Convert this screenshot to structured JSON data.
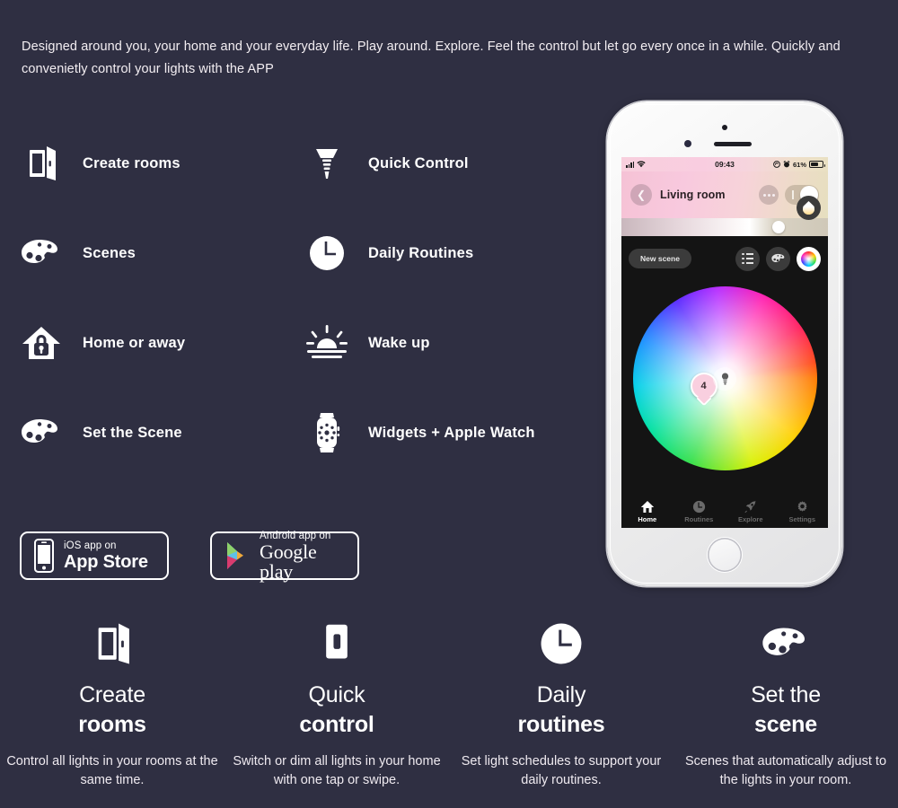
{
  "theme": {
    "background": "#2f2f42",
    "text_primary": "#ffffff",
    "text_body": "#efeaf0",
    "phone_screen_bg": "#141414",
    "accent_pink": "#f9cfdf"
  },
  "intro": {
    "paragraph": "Designed around you, your home and your everyday life. Play around. Explore. Feel the control but let go every once in a while. Quickly and convenietly control your lights with the  APP"
  },
  "features": [
    {
      "label": "Create rooms",
      "icon": "open-door-icon"
    },
    {
      "label": "Quick Control",
      "icon": "light-bulb-icon"
    },
    {
      "label": "Scenes",
      "icon": "paint-palette-icon"
    },
    {
      "label": "Daily Routines",
      "icon": "clock-icon"
    },
    {
      "label": "Home or away",
      "icon": "house-lock-icon"
    },
    {
      "label": "Wake up",
      "icon": "sunrise-icon"
    },
    {
      "label": "Set the Scene",
      "icon": "paint-palette-icon"
    },
    {
      "label": "Widgets + Apple Watch",
      "icon": "apple-watch-icon"
    }
  ],
  "store_badges": [
    {
      "top": "iOS app on",
      "bottom": "App Store",
      "icon": "iphone-icon"
    },
    {
      "top": "Android app on",
      "bottom": "Google play",
      "icon": "google-play-triangle-icon"
    }
  ],
  "bottom_cards": [
    {
      "title_line1": "Create",
      "title_line2": "rooms",
      "desc": "Control all lights in your rooms at the same time.",
      "icon": "open-door-icon"
    },
    {
      "title_line1": "Quick",
      "title_line2": "control",
      "desc": "Switch or dim all lights in your home with one tap or swipe.",
      "icon": "light-switch-icon"
    },
    {
      "title_line1": "Daily",
      "title_line2": "routines",
      "desc": "Set light schedules to support your daily routines.",
      "icon": "clock-icon"
    },
    {
      "title_line1": "Set the",
      "title_line2": "scene",
      "desc": "Scenes that automatically adjust to the lights in your room.",
      "icon": "paint-palette-icon"
    }
  ],
  "phone": {
    "status_bar": {
      "time": "09:43",
      "battery_percent": "61%",
      "signal_icon": "cellular-bars-icon",
      "wifi_icon": "wifi-icon",
      "rotation_lock_icon": "rotation-lock-icon",
      "alarm_icon": "alarm-icon",
      "battery_icon": "battery-icon"
    },
    "room_header": {
      "room_name": "Living room",
      "back_icon": "chevron-left-icon",
      "more_icon": "more-dots-icon",
      "power_toggle": "on",
      "brightness_percent": 74
    },
    "controls": {
      "new_scene_label": "New scene",
      "buttons": [
        {
          "icon": "scene-list-icon",
          "active": false
        },
        {
          "icon": "palette-icon",
          "active": false
        },
        {
          "icon": "color-wheel-icon",
          "active": true
        },
        {
          "icon": "white-temperature-icon",
          "active": false
        }
      ]
    },
    "color_wheel": {
      "pin_label": "4",
      "bulb_marker_icon": "light-bulb-icon"
    },
    "tabs": [
      {
        "label": "Home",
        "icon": "home-icon",
        "active": true
      },
      {
        "label": "Routines",
        "icon": "clock-icon",
        "active": false
      },
      {
        "label": "Explore",
        "icon": "rocket-icon",
        "active": false
      },
      {
        "label": "Settings",
        "icon": "gear-icon",
        "active": false
      }
    ]
  }
}
